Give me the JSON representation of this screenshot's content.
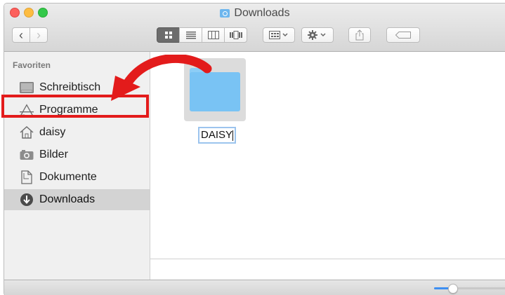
{
  "window": {
    "title": "Downloads",
    "title_icon": "downloads-folder-icon"
  },
  "toolbar": {
    "back_glyph": "‹",
    "forward_glyph": "›",
    "view_modes": [
      "icon-view",
      "list-view",
      "column-view",
      "cover-flow-view"
    ],
    "active_view": "icon-view",
    "arrange_icon": "arrange-grid-icon",
    "action_icon": "gear-icon",
    "share_icon": "share-icon",
    "tag_icon": "tag-icon"
  },
  "sidebar": {
    "heading": "Favoriten",
    "items": [
      {
        "label": "Schreibtisch",
        "icon": "desktop-icon"
      },
      {
        "label": "Programme",
        "icon": "applications-icon"
      },
      {
        "label": "daisy",
        "icon": "home-icon"
      },
      {
        "label": "Bilder",
        "icon": "camera-icon"
      },
      {
        "label": "Dokumente",
        "icon": "document-icon"
      },
      {
        "label": "Downloads",
        "icon": "download-icon",
        "selected": true
      }
    ]
  },
  "content": {
    "items": [
      {
        "name": "DAISY",
        "type": "folder",
        "renaming": true
      }
    ]
  },
  "status": {
    "icon_size_slider": 0.25
  },
  "annotation": {
    "highlight_color": "#e31b1b",
    "arrow_color": "#e31b1b"
  }
}
